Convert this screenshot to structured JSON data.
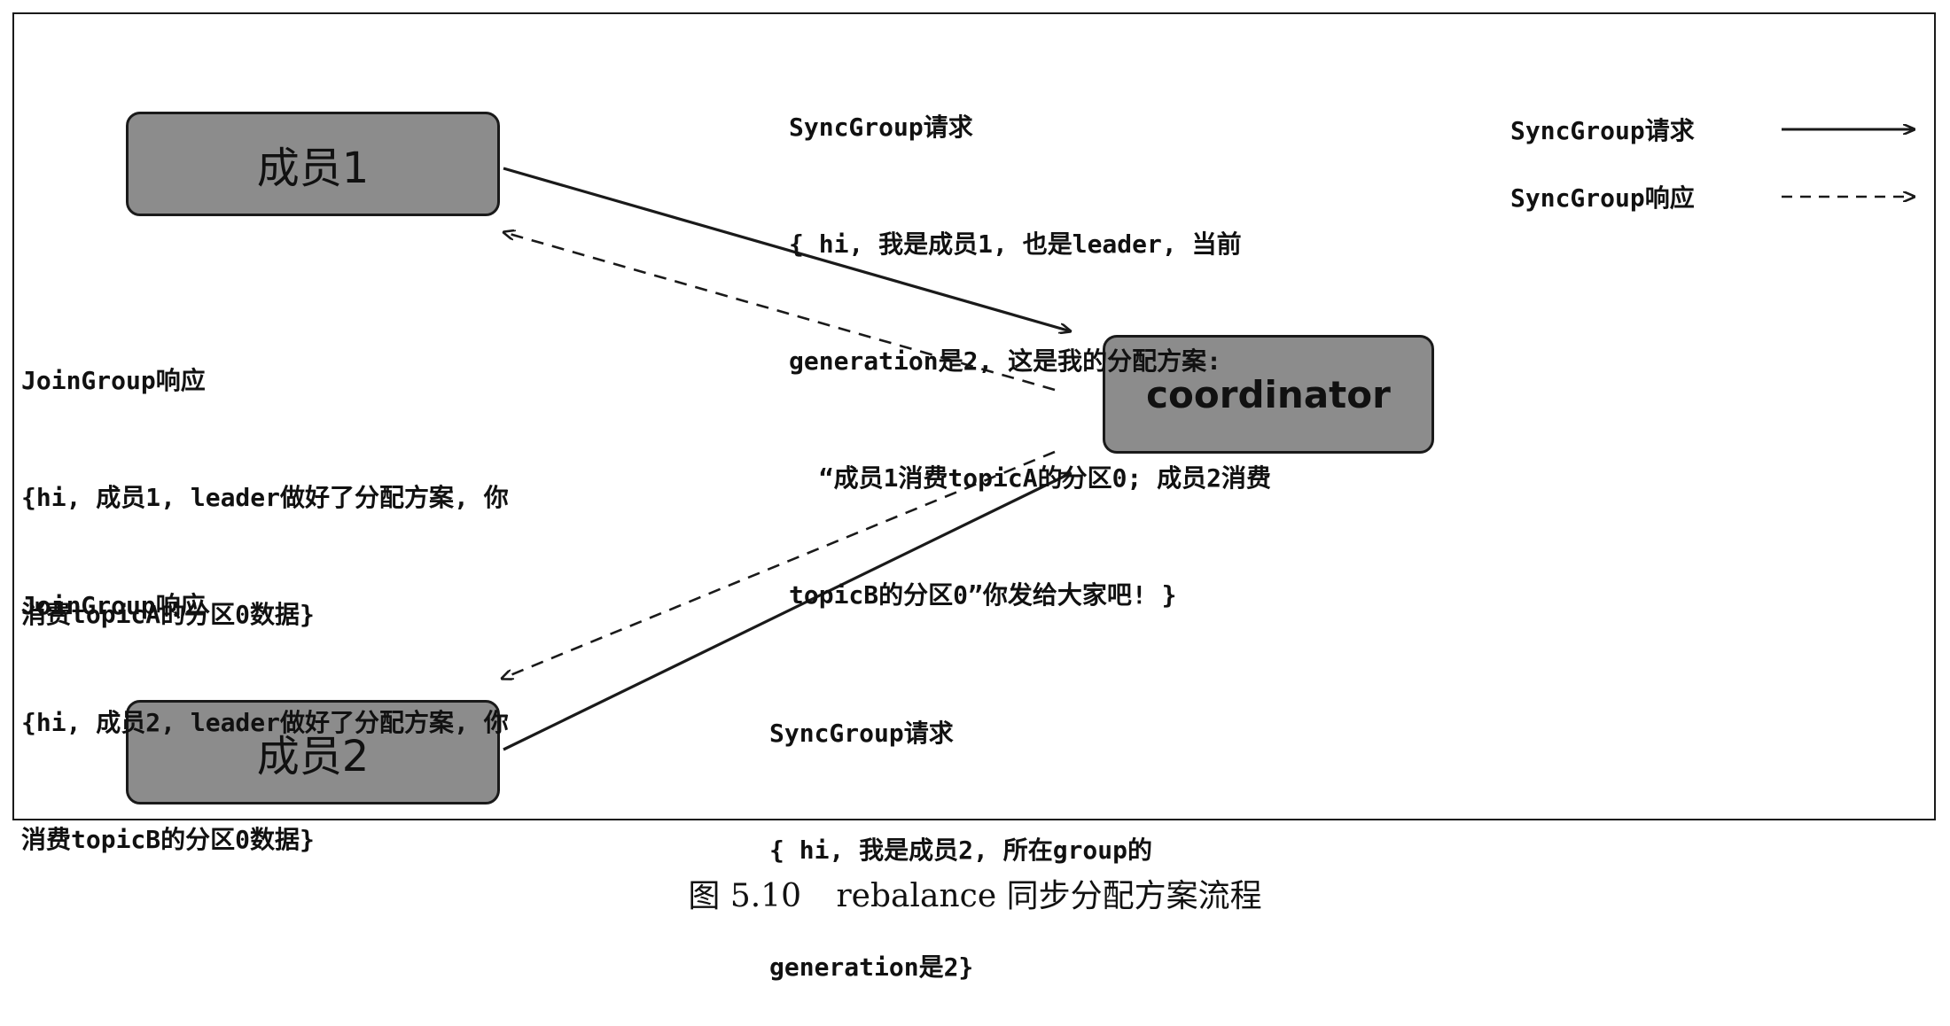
{
  "nodes": {
    "member1": "成员1",
    "member2": "成员2",
    "coordinator": "coordinator"
  },
  "messages": {
    "sync_request_1": {
      "title": "SyncGroup请求",
      "lines": [
        "{ hi, 我是成员1, 也是leader, 当前",
        "generation是2, 这是我的分配方案:",
        "  “成员1消费topicA的分区0; 成员2消费",
        "topicB的分区0”你发给大家吧! }"
      ]
    },
    "join_response_1": {
      "title": "JoinGroup响应",
      "lines": [
        "{hi, 成员1, leader做好了分配方案, 你",
        "消费topicA的分区0数据}"
      ]
    },
    "join_response_2": {
      "title": "JoinGroup响应",
      "lines": [
        "{hi, 成员2, leader做好了分配方案, 你",
        "消费topicB的分区0数据}"
      ]
    },
    "sync_request_2": {
      "title": "SyncGroup请求",
      "lines": [
        "{ hi, 我是成员2, 所在group的",
        "generation是2}"
      ]
    }
  },
  "legend": {
    "request": "SyncGroup请求",
    "response": "SyncGroup响应"
  },
  "caption": {
    "figure_number": "图 5.10",
    "title": "rebalance 同步分配方案流程"
  }
}
